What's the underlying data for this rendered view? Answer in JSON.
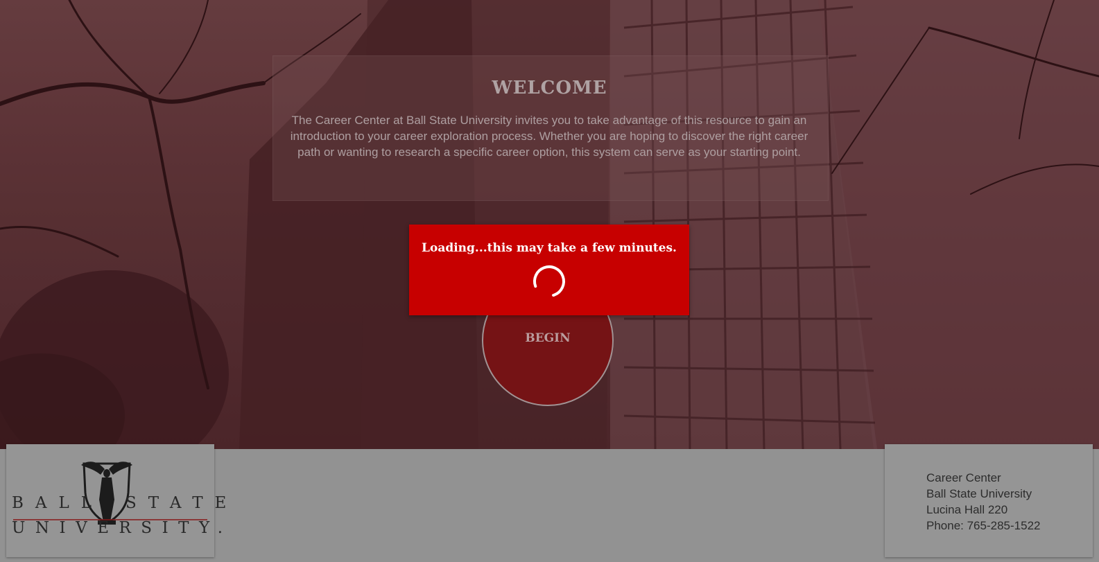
{
  "welcome": {
    "title": "WELCOME",
    "description": "The Career Center at Ball State University invites you to take advantage of this resource to gain an introduction to your career exploration process. Whether you are hoping to discover the right career path or wanting to research a specific career option, this system can serve as your starting point."
  },
  "begin": {
    "label": "BEGIN"
  },
  "loading": {
    "message": "Loading...this may take a few minutes.",
    "icon": "spinner-icon"
  },
  "logo": {
    "line1_left": "BALL",
    "line1_right": "STATE",
    "line2": "UNIVERSITY.",
    "icon": "beneficence-statue-icon"
  },
  "contact": {
    "line1": "Career Center",
    "line2": "Ball State University",
    "line3": "Lucina Hall 220",
    "line4": "Phone: 765-285-1522"
  },
  "colors": {
    "overlay": "#5c3236",
    "modal": "#c70000",
    "begin_button": "#7a1416",
    "footer": "#989898"
  }
}
